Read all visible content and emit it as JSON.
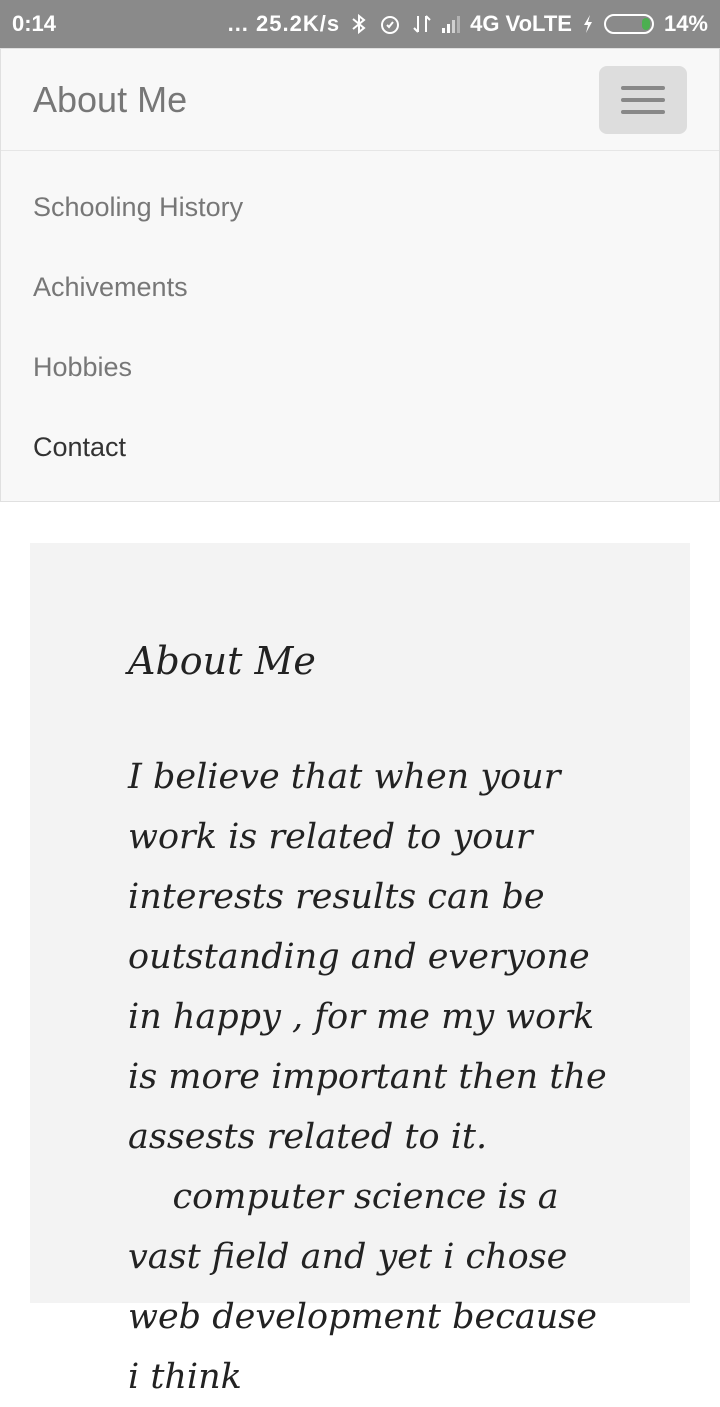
{
  "status_bar": {
    "time": "0:14",
    "speed": "... 25.2K/s",
    "network": "4G VoLTE",
    "battery_percent": "14%",
    "battery_level": 0.14,
    "icons": [
      "bluetooth-icon",
      "alarm-icon",
      "data-transfer-icon",
      "signal-icon",
      "charging-icon",
      "battery-icon"
    ]
  },
  "navbar": {
    "brand": "About Me",
    "toggle_icon": "hamburger-menu-icon",
    "items": [
      {
        "label": "Schooling History"
      },
      {
        "label": "Achivements"
      },
      {
        "label": "Hobbies"
      },
      {
        "label": "Contact",
        "active": true
      }
    ]
  },
  "content": {
    "title": "About Me",
    "paragraph": "I believe that when your work is related to your interests results can be outstanding and everyone in happy , for me my work is more important then the assests related to it.\n    computer science is a vast field and yet i chose web development because i think"
  }
}
